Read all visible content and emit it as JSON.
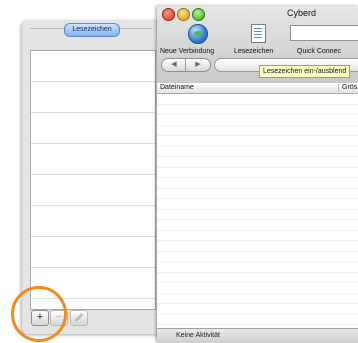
{
  "window": {
    "title": "Cyberd"
  },
  "toolbar": {
    "new_connection_label": "Neue Verbindung",
    "bookmarks_label": "Lesezeichen",
    "quick_connect_label": "Quick Connec",
    "quick_connect_value": ""
  },
  "navigation": {
    "back_glyph": "◀",
    "forward_glyph": "▶"
  },
  "tooltip": {
    "text": "Lesezeichen ein-/ausblend"
  },
  "file_browser": {
    "columns": [
      {
        "label": "Dateiname"
      },
      {
        "label": "Grös"
      }
    ],
    "rows": []
  },
  "status": {
    "text": "Keine Aktivität"
  },
  "drawer": {
    "tab_label": "Lesezeichen",
    "bookmarks": [],
    "add_label": "+",
    "remove_label": "−"
  },
  "colors": {
    "highlight": "#f08b1e",
    "tab_accent": "#7fb2f0"
  },
  "icons": {
    "new_connection": "globe-icon",
    "bookmarks": "document-icon",
    "edit": "pencil-icon"
  }
}
